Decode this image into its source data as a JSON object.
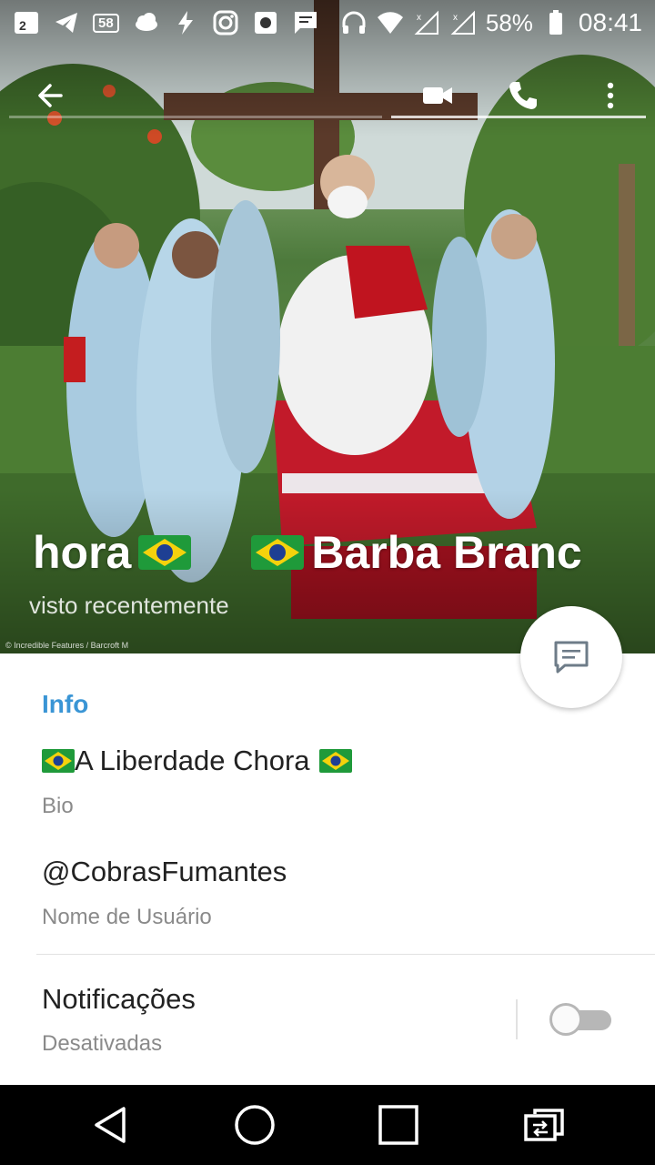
{
  "status_bar": {
    "badge_value": "58",
    "battery_percent": "58%",
    "time": "08:41"
  },
  "toolbar": {
    "back_icon": "arrow-left-icon",
    "video_call_icon": "video-camera-icon",
    "call_icon": "phone-icon",
    "more_icon": "more-vert-icon"
  },
  "profile": {
    "name_left": "hora",
    "name_right": "Barba Branc",
    "last_seen": "visto recentemente",
    "photo_credit": "© Incredible Features / Barcroft M"
  },
  "fab": {
    "icon": "message-icon"
  },
  "info": {
    "section_title": "Info",
    "bio_value": "A Liberdade Chora",
    "bio_label": "Bio",
    "username_value": "@CobrasFumantes",
    "username_label": "Nome de Usuário",
    "notifications_label": "Notificações",
    "notifications_status": "Desativadas",
    "notifications_enabled": false
  },
  "nav": {
    "back_icon": "nav-back-triangle-icon",
    "home_icon": "nav-home-circle-icon",
    "recents_icon": "nav-recents-square-icon",
    "switch_icon": "nav-switch-icon"
  },
  "colors": {
    "accent": "#3a95d5",
    "toggle_off": "#b7b7b7",
    "navbar": "#000000"
  }
}
